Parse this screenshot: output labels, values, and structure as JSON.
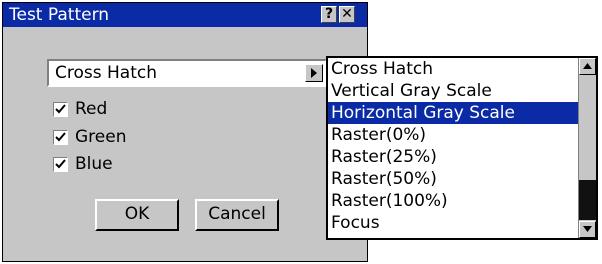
{
  "window": {
    "title": "Test Pattern",
    "help_glyph": "?",
    "close_glyph": "✕"
  },
  "pattern_select": {
    "value": "Cross Hatch",
    "icon": "chevron-right-icon"
  },
  "channels": [
    {
      "label": "Red",
      "checked": true
    },
    {
      "label": "Green",
      "checked": true
    },
    {
      "label": "Blue",
      "checked": true
    }
  ],
  "buttons": {
    "ok": "OK",
    "cancel": "Cancel"
  },
  "dropdown": {
    "items": [
      "Cross Hatch",
      "Vertical Gray Scale",
      "Horizontal Gray Scale",
      "Raster(0%)",
      "Raster(25%)",
      "Raster(50%)",
      "Raster(100%)",
      "Focus"
    ],
    "selected": "Horizontal Gray Scale"
  },
  "colors": {
    "titlebar": "#0a2aa6",
    "face": "#c6c6c6",
    "selection": "#0a2aa6"
  }
}
